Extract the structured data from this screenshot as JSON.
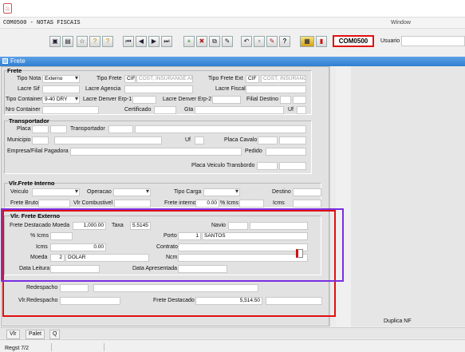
{
  "window": {
    "title": "COM0500 - NOTAS FISCAIS",
    "menu_label": "Window"
  },
  "toolbar": {
    "module_code": "COM0500",
    "usuario_label": "Usuario",
    "usuario_value": ""
  },
  "frame": {
    "title": "Frete"
  },
  "frete": {
    "title": "Frete",
    "tipo_nota_label": "Tipo Nota",
    "tipo_nota_value": "Externo",
    "tipo_frete_label": "Tipo Frete",
    "tipo_frete_code": "CIF",
    "tipo_frete_desc": "COST, INSURANGE AN",
    "tipo_frete_ext_label": "Tipo Frete Ext",
    "tipo_frete_ext_code": "CIF",
    "tipo_frete_ext_desc": "COST, INSURANG",
    "lacre_sif_label": "Lacre Sif",
    "lacre_agencia_label": "Lacre Agencia",
    "lacre_fiscal_label": "Lacre Fiscal",
    "tipo_container_label": "Tipo Container",
    "tipo_container_value": "9-40 DRY",
    "lacre_denver1_label": "Lacre Denver Erp-1",
    "lacre_denver2_label": "Lacre Denver Erp-2",
    "filial_destino_label": "Filial Destino",
    "nro_container_label": "Nro Container",
    "certificado_label": "Certificado",
    "gta_label": "Gta",
    "uf_label": "Uf"
  },
  "transportador": {
    "title": "Transportador",
    "placa_label": "Placa",
    "transportador_label": "Transportador",
    "municipio_label": "Municipio",
    "uf_label": "Uf",
    "placa_cavalo_label": "Placa Cavalo",
    "empresa_label": "Empresa/Filial Pagadora",
    "pedido_label": "Pedido",
    "placa_transbordo_label": "Placa Veiculo Transbordo"
  },
  "frete_interno": {
    "title": "Vlr.Frete Interno",
    "veiculo_label": "Veiculo",
    "operacao_label": "Operacao",
    "tipo_carga_label": "Tipo Carga",
    "destino_label": "Destino",
    "frete_bruto_label": "Frete Bruto",
    "vlr_combustivel_label": "Vlr Combustivel",
    "frete_interno_label": "Frete interno",
    "frete_interno_value": "0.00",
    "pct_icms_label": "% Icms",
    "icms_label": "Icms"
  },
  "frete_externo": {
    "title": "Vlr. Frete Externo",
    "frete_destacado_moeda_label": "Frete Destacado Moeda",
    "frete_destacado_moeda_value": "1,000.00",
    "taxa_label": "Taxa",
    "taxa_value": "5.5145",
    "navio_label": "Navio",
    "pct_icms_label": "% Icms",
    "porto_label": "Porto",
    "porto_code": "1",
    "porto_name": "SANTOS",
    "icms_label": "Icms",
    "icms_value": "0.00",
    "contrato_label": "Contrato",
    "moeda_label": "Moeda",
    "moeda_code": "2",
    "moeda_name": "DOLAR",
    "ncm_label": "Ncm",
    "data_leitura_label": "Data Leitura",
    "data_apresentada_label": "Data Apresentada"
  },
  "redespacho": {
    "redespacho_label": "Redespacho",
    "vlr_redespacho_label": "Vlr.Redespacho",
    "frete_destacado_label": "Frete Destacado",
    "frete_destacado_value": "5,514.50"
  },
  "footer": {
    "duplica_nf_label": "Duplica NF",
    "tab1": "Vlr",
    "tab2": "Palet",
    "tab3": "Q",
    "status_text": "Regst 7/2"
  },
  "colors": {
    "accent_blue": "#2f7fd0",
    "highlight_red": "#e01010",
    "highlight_purple": "#7a2fe0"
  }
}
